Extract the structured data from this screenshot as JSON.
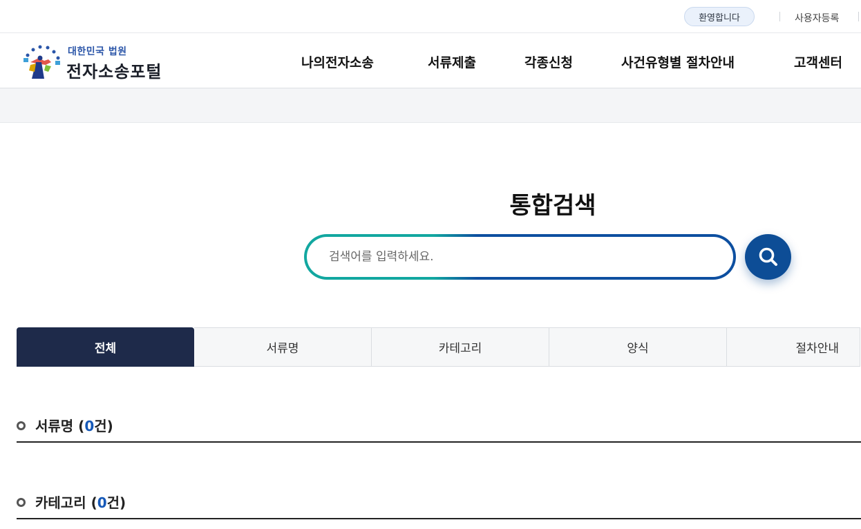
{
  "util": {
    "welcome": "환영합니다",
    "register": "사용자등록"
  },
  "logo": {
    "sub": "대한민국 법원",
    "main": "전자소송포털"
  },
  "nav": [
    {
      "label": "나의전자소송"
    },
    {
      "label": "서류제출"
    },
    {
      "label": "각종신청"
    },
    {
      "label": "사건유형별 절차안내"
    },
    {
      "label": "고객센터"
    }
  ],
  "search": {
    "title": "통합검색",
    "placeholder": "검색어를 입력하세요."
  },
  "tabs": [
    {
      "label": "전체",
      "active": true
    },
    {
      "label": "서류명"
    },
    {
      "label": "카테고리"
    },
    {
      "label": "양식"
    },
    {
      "label": "절차안내"
    }
  ],
  "results": [
    {
      "title": "서류명",
      "count": "0",
      "unit": "건"
    },
    {
      "title": "카테고리",
      "count": "0",
      "unit": "건"
    }
  ],
  "colors": {
    "navy": "#1e2a4a",
    "brand_blue": "#0d4d96",
    "teal": "#12a7a0",
    "count_blue": "#1659b8"
  }
}
